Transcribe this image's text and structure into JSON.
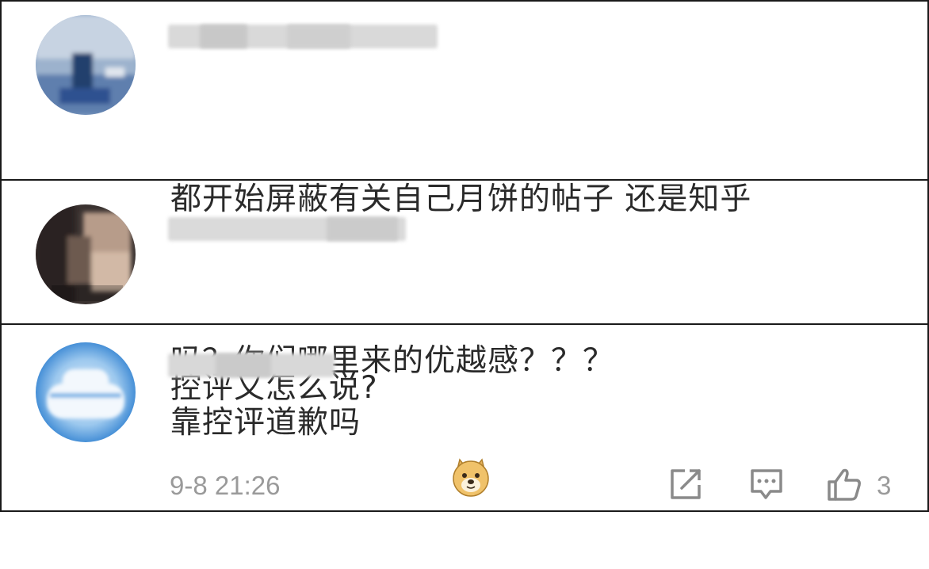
{
  "comments": [
    {
      "text_lines": [
        "都开始屏蔽有关自己月饼的帖子 还是知乎",
        "吗？你们哪里来的优越感？？？"
      ]
    },
    {
      "text_lines": [
        "控评又怎么说?"
      ]
    },
    {
      "text_lines": [
        "靠控评道歉吗"
      ],
      "emoji": "doge-emoji",
      "timestamp": "9-8 21:26",
      "like_count": "3"
    }
  ],
  "icons": {
    "share": "share-icon",
    "reply": "comment-icon",
    "like": "thumbs-up-icon"
  },
  "colors": {
    "border": "#1a1a1a",
    "text": "#2a2a2a",
    "meta": "#9a9a9a"
  }
}
